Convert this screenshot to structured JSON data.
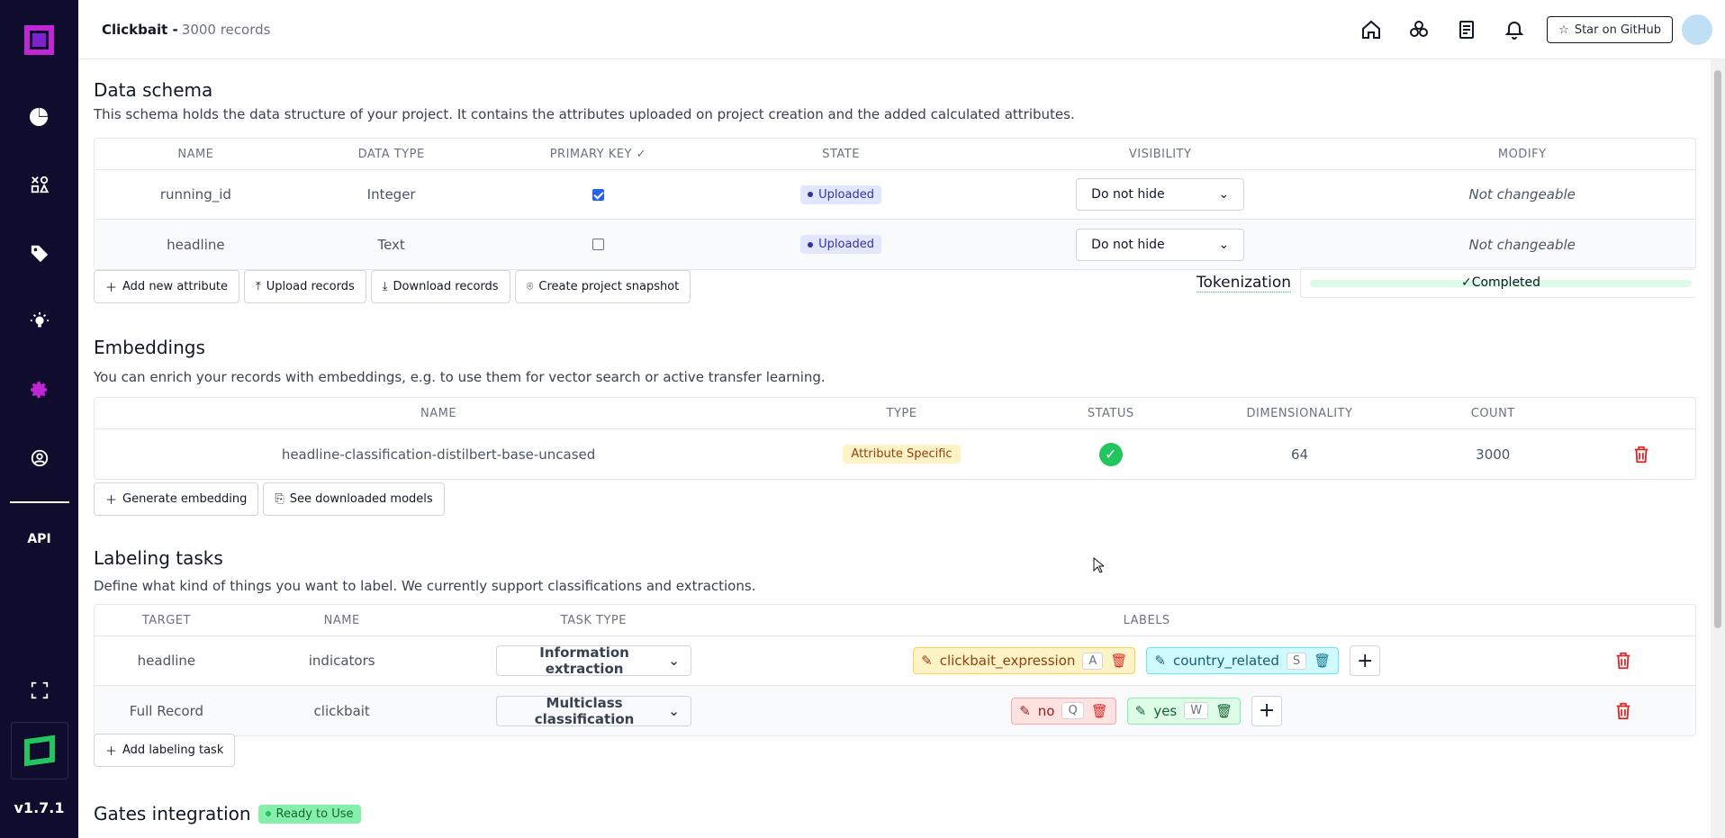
{
  "sidebar": {
    "api_label": "API",
    "version": "v1.7.1"
  },
  "header": {
    "project": "Clickbait -",
    "records": "3000 records",
    "github": "Star on GitHub"
  },
  "schema": {
    "title": "Data schema",
    "desc": "This schema holds the data structure of your project. It contains the attributes uploaded on project creation and the added calculated attributes.",
    "columns": [
      "NAME",
      "DATA TYPE",
      "PRIMARY KEY",
      "STATE",
      "VISIBILITY",
      "MODIFY"
    ],
    "rows": [
      {
        "name": "running_id",
        "type": "Integer",
        "state": "Uploaded",
        "visibility": "Do not hide",
        "modify": "Not changeable",
        "primary": true
      },
      {
        "name": "headline",
        "type": "Text",
        "state": "Uploaded",
        "visibility": "Do not hide",
        "modify": "Not changeable",
        "primary": false
      }
    ],
    "buttons": {
      "add": "Add new attribute",
      "upload": "Upload records",
      "download": "Download records",
      "snapshot": "Create project snapshot"
    },
    "tokenization_label": "Tokenization",
    "tokenization_status": "Completed"
  },
  "embeddings": {
    "title": "Embeddings",
    "desc": "You can enrich your records with embeddings, e.g. to use them for vector search or active transfer learning.",
    "columns": [
      "NAME",
      "TYPE",
      "STATUS",
      "DIMENSIONALITY",
      "COUNT"
    ],
    "rows": [
      {
        "name": "headline-classification-distilbert-base-uncased",
        "type": "Attribute Specific",
        "dim": "64",
        "count": "3000"
      }
    ],
    "buttons": {
      "generate": "Generate embedding",
      "models": "See downloaded models"
    }
  },
  "labeling": {
    "title": "Labeling tasks",
    "desc": "Define what kind of things you want to label. We currently support classifications and extractions.",
    "columns": [
      "TARGET",
      "NAME",
      "TASK TYPE",
      "LABELS"
    ],
    "rows": [
      {
        "target": "headline",
        "name": "indicators",
        "task": "Information extraction",
        "labels": [
          {
            "name": "clickbait_expression",
            "key": "A"
          },
          {
            "name": "country_related",
            "key": "S"
          }
        ]
      },
      {
        "target": "Full Record",
        "name": "clickbait",
        "task": "Multiclass classification",
        "labels": [
          {
            "name": "no",
            "key": "Q"
          },
          {
            "name": "yes",
            "key": "W"
          }
        ]
      }
    ],
    "add_button": "Add labeling task"
  },
  "gates": {
    "title": "Gates integration",
    "status": "Ready to Use"
  }
}
